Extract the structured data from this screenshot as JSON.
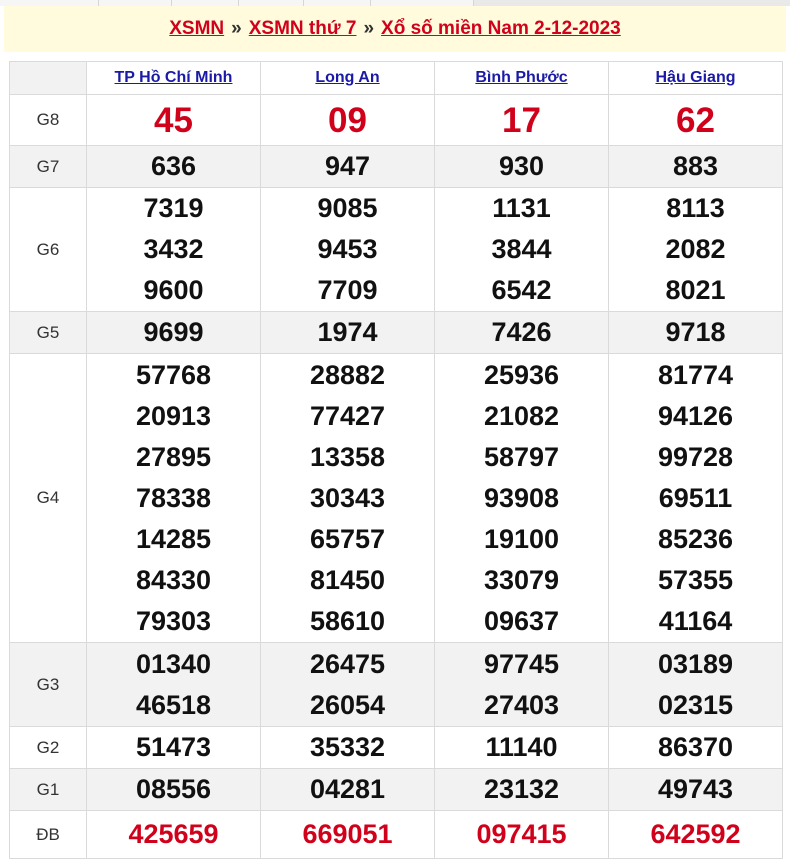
{
  "breadcrumb": {
    "links": [
      "XSMN",
      "XSMN thứ 7",
      "Xổ số miền Nam 2-12-2023"
    ],
    "separator": "»"
  },
  "provinces": [
    "TP Hồ Chí Minh",
    "Long An",
    "Bình Phước",
    "Hậu Giang"
  ],
  "prizes": [
    {
      "label": "G8",
      "style": "red-big",
      "rows": [
        [
          "45",
          "09",
          "17",
          "62"
        ]
      ]
    },
    {
      "label": "G7",
      "style": "normal",
      "rows": [
        [
          "636",
          "947",
          "930",
          "883"
        ]
      ]
    },
    {
      "label": "G6",
      "style": "normal",
      "rows": [
        [
          "7319",
          "9085",
          "1131",
          "8113"
        ],
        [
          "3432",
          "9453",
          "3844",
          "2082"
        ],
        [
          "9600",
          "7709",
          "6542",
          "8021"
        ]
      ]
    },
    {
      "label": "G5",
      "style": "normal",
      "rows": [
        [
          "9699",
          "1974",
          "7426",
          "9718"
        ]
      ]
    },
    {
      "label": "G4",
      "style": "normal",
      "rows": [
        [
          "57768",
          "28882",
          "25936",
          "81774"
        ],
        [
          "20913",
          "77427",
          "21082",
          "94126"
        ],
        [
          "27895",
          "13358",
          "58797",
          "99728"
        ],
        [
          "78338",
          "30343",
          "93908",
          "69511"
        ],
        [
          "14285",
          "65757",
          "19100",
          "85236"
        ],
        [
          "84330",
          "81450",
          "33079",
          "57355"
        ],
        [
          "79303",
          "58610",
          "09637",
          "41164"
        ]
      ]
    },
    {
      "label": "G3",
      "style": "normal",
      "rows": [
        [
          "01340",
          "26475",
          "97745",
          "03189"
        ],
        [
          "46518",
          "26054",
          "27403",
          "02315"
        ]
      ]
    },
    {
      "label": "G2",
      "style": "normal",
      "rows": [
        [
          "51473",
          "35332",
          "11140",
          "86370"
        ]
      ]
    },
    {
      "label": "G1",
      "style": "normal",
      "rows": [
        [
          "08556",
          "04281",
          "23132",
          "49743"
        ]
      ]
    },
    {
      "label": "ĐB",
      "style": "red",
      "rows": [
        [
          "425659",
          "669051",
          "097415",
          "642592"
        ]
      ]
    }
  ],
  "colors": {
    "accent_red": "#d0021b",
    "link_blue": "#1a1aa6",
    "header_bg": "#fffbdc",
    "alt_row_bg": "#f2f2f2"
  }
}
